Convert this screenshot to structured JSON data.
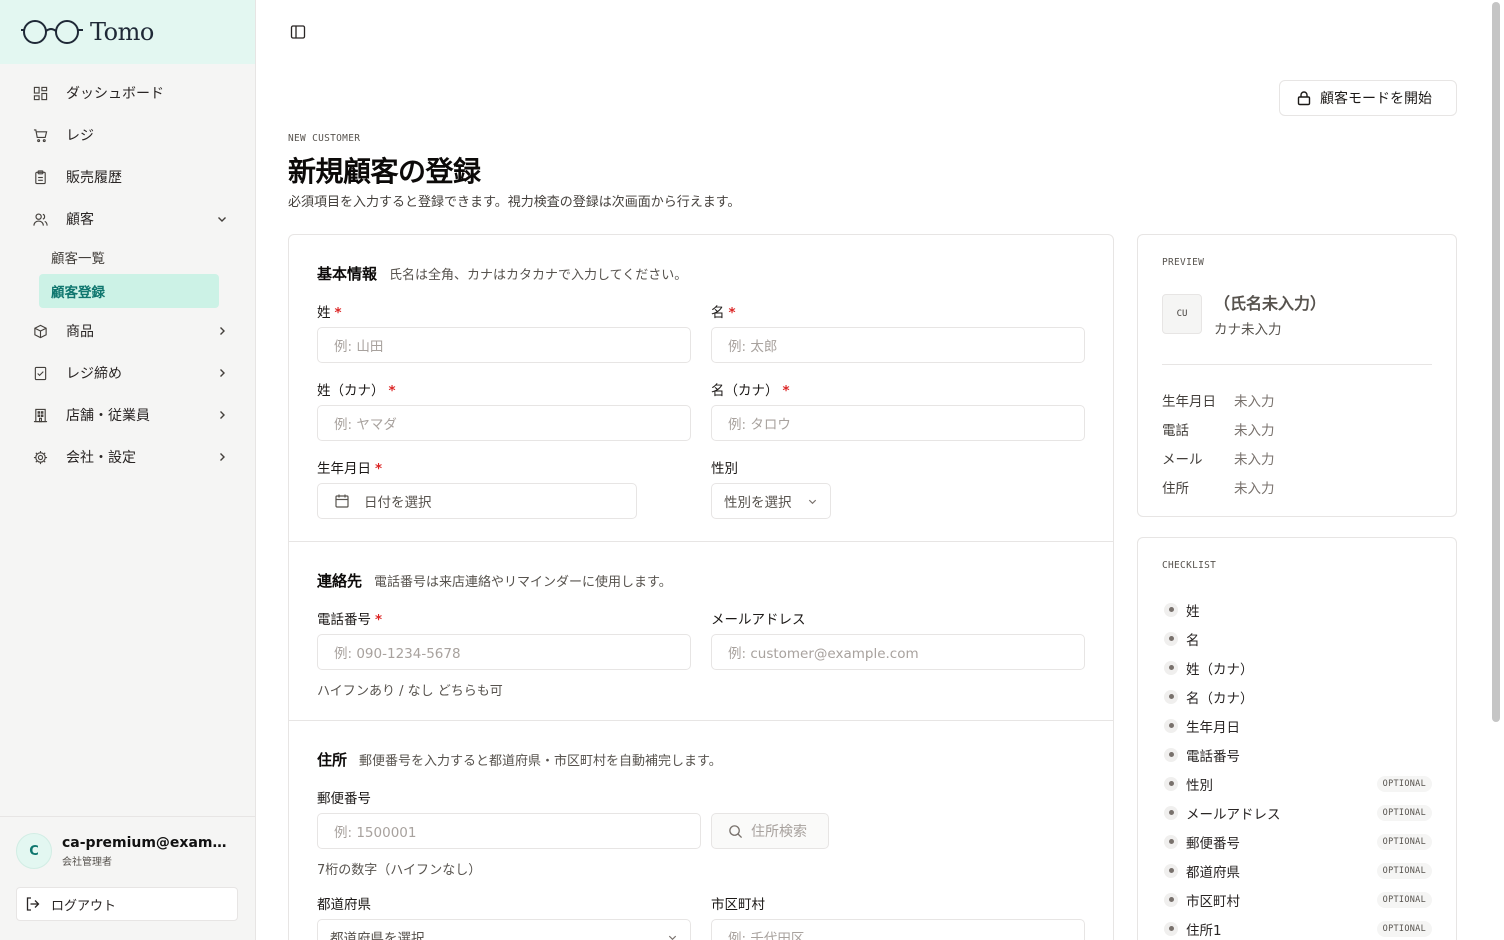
{
  "brand": {
    "name": "Tomo"
  },
  "sidebar": {
    "items": [
      {
        "label": "ダッシュボード",
        "icon": "dashboard-icon"
      },
      {
        "label": "レジ",
        "icon": "cart-icon"
      },
      {
        "label": "販売履歴",
        "icon": "clipboard-icon"
      },
      {
        "label": "顧客",
        "icon": "users-icon",
        "expanded": true
      },
      {
        "label": "商品",
        "icon": "package-icon"
      },
      {
        "label": "レジ締め",
        "icon": "checklist-icon"
      },
      {
        "label": "店舗・従業員",
        "icon": "building-icon"
      },
      {
        "label": "会社・設定",
        "icon": "gear-icon"
      }
    ],
    "customer_sub": [
      {
        "label": "顧客一覧"
      },
      {
        "label": "顧客登録",
        "active": true
      }
    ]
  },
  "user": {
    "initial": "C",
    "email": "ca-premium@example.com",
    "role": "会社管理者",
    "logout_label": "ログアウト"
  },
  "header": {
    "customer_mode_label": "顧客モードを開始",
    "eyebrow": "NEW CUSTOMER",
    "title": "新規顧客の登録",
    "subtitle": "必須項目を入力すると登録できます。視力検査の登録は次画面から行えます。"
  },
  "basic": {
    "title": "基本情報",
    "desc": "氏名は全角、カナはカタカナで入力してください。",
    "last_name": {
      "label": "姓",
      "placeholder": "例: 山田"
    },
    "first_name": {
      "label": "名",
      "placeholder": "例: 太郎"
    },
    "last_kana": {
      "label": "姓（カナ）",
      "placeholder": "例: ヤマダ"
    },
    "first_kana": {
      "label": "名（カナ）",
      "placeholder": "例: タロウ"
    },
    "birthdate": {
      "label": "生年月日",
      "placeholder": "日付を選択"
    },
    "gender": {
      "label": "性別",
      "value": "性別を選択"
    }
  },
  "contact": {
    "title": "連絡先",
    "desc": "電話番号は来店連絡やリマインダーに使用します。",
    "phone": {
      "label": "電話番号",
      "placeholder": "例: 090-1234-5678",
      "hint": "ハイフンあり / なし どちらも可"
    },
    "email": {
      "label": "メールアドレス",
      "placeholder": "例: customer@example.com"
    }
  },
  "address": {
    "title": "住所",
    "desc": "郵便番号を入力すると都道府県・市区町村を自動補完します。",
    "postal": {
      "label": "郵便番号",
      "placeholder": "例: 1500001",
      "hint": "7桁の数字（ハイフンなし）"
    },
    "search_label": "住所検索",
    "prefecture": {
      "label": "都道府県",
      "value": "都道府県を選択"
    },
    "city": {
      "label": "市区町村",
      "placeholder": "例: 千代田区"
    }
  },
  "preview": {
    "label": "PREVIEW",
    "avatar": "CU",
    "name": "（氏名未入力）",
    "kana": "カナ未入力",
    "rows": [
      {
        "key": "生年月日",
        "value": "未入力"
      },
      {
        "key": "電話",
        "value": "未入力"
      },
      {
        "key": "メール",
        "value": "未入力"
      },
      {
        "key": "住所",
        "value": "未入力"
      }
    ]
  },
  "checklist": {
    "label": "CHECKLIST",
    "optional_label": "OPTIONAL",
    "items": [
      {
        "label": "姓",
        "optional": false
      },
      {
        "label": "名",
        "optional": false
      },
      {
        "label": "姓（カナ）",
        "optional": false
      },
      {
        "label": "名（カナ）",
        "optional": false
      },
      {
        "label": "生年月日",
        "optional": false
      },
      {
        "label": "電話番号",
        "optional": false
      },
      {
        "label": "性別",
        "optional": true
      },
      {
        "label": "メールアドレス",
        "optional": true
      },
      {
        "label": "郵便番号",
        "optional": true
      },
      {
        "label": "都道府県",
        "optional": true
      },
      {
        "label": "市区町村",
        "optional": true
      },
      {
        "label": "住所1",
        "optional": true
      }
    ]
  },
  "colors": {
    "accent": "#0f766e",
    "accent_bg": "#ccf2e6",
    "brand_bg": "#e3f7f1",
    "required": "#dc2626"
  }
}
